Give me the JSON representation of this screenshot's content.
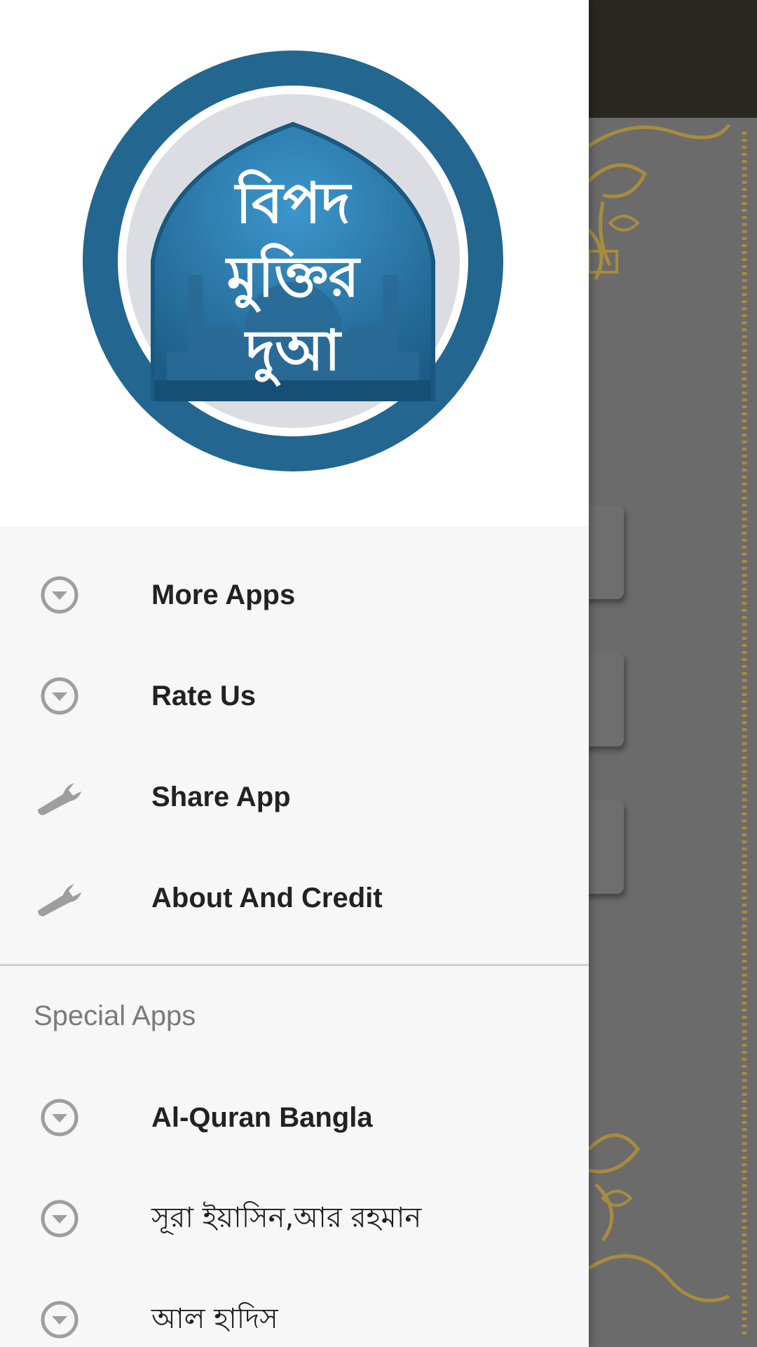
{
  "app_logo": {
    "name": "বিপদ মুক্তির দুআ",
    "lines": [
      "বিপদ",
      "মুক্তির",
      "দুআ"
    ]
  },
  "drawer": {
    "items": [
      {
        "label": "More Apps",
        "icon": "chevron-down-circle-icon"
      },
      {
        "label": "Rate Us",
        "icon": "chevron-down-circle-icon"
      },
      {
        "label": "Share App",
        "icon": "wrench-icon"
      },
      {
        "label": "About And Credit",
        "icon": "wrench-icon"
      }
    ],
    "section_title": "Special Apps",
    "special_items": [
      {
        "label": "Al-Quran Bangla",
        "icon": "chevron-down-circle-icon"
      },
      {
        "label": "সূরা ইয়াসিন,আর রহমান",
        "icon": "chevron-down-circle-icon"
      },
      {
        "label": "আল হাদিস",
        "icon": "chevron-down-circle-icon"
      }
    ]
  },
  "colors": {
    "logo_ring": "#23668f",
    "logo_inner": "#2c7fb5",
    "drawer_bg": "#f7f7f7",
    "header_bg": "#ffffff",
    "scrim": "#6b6b6b",
    "ornament": "#c9a94c"
  }
}
